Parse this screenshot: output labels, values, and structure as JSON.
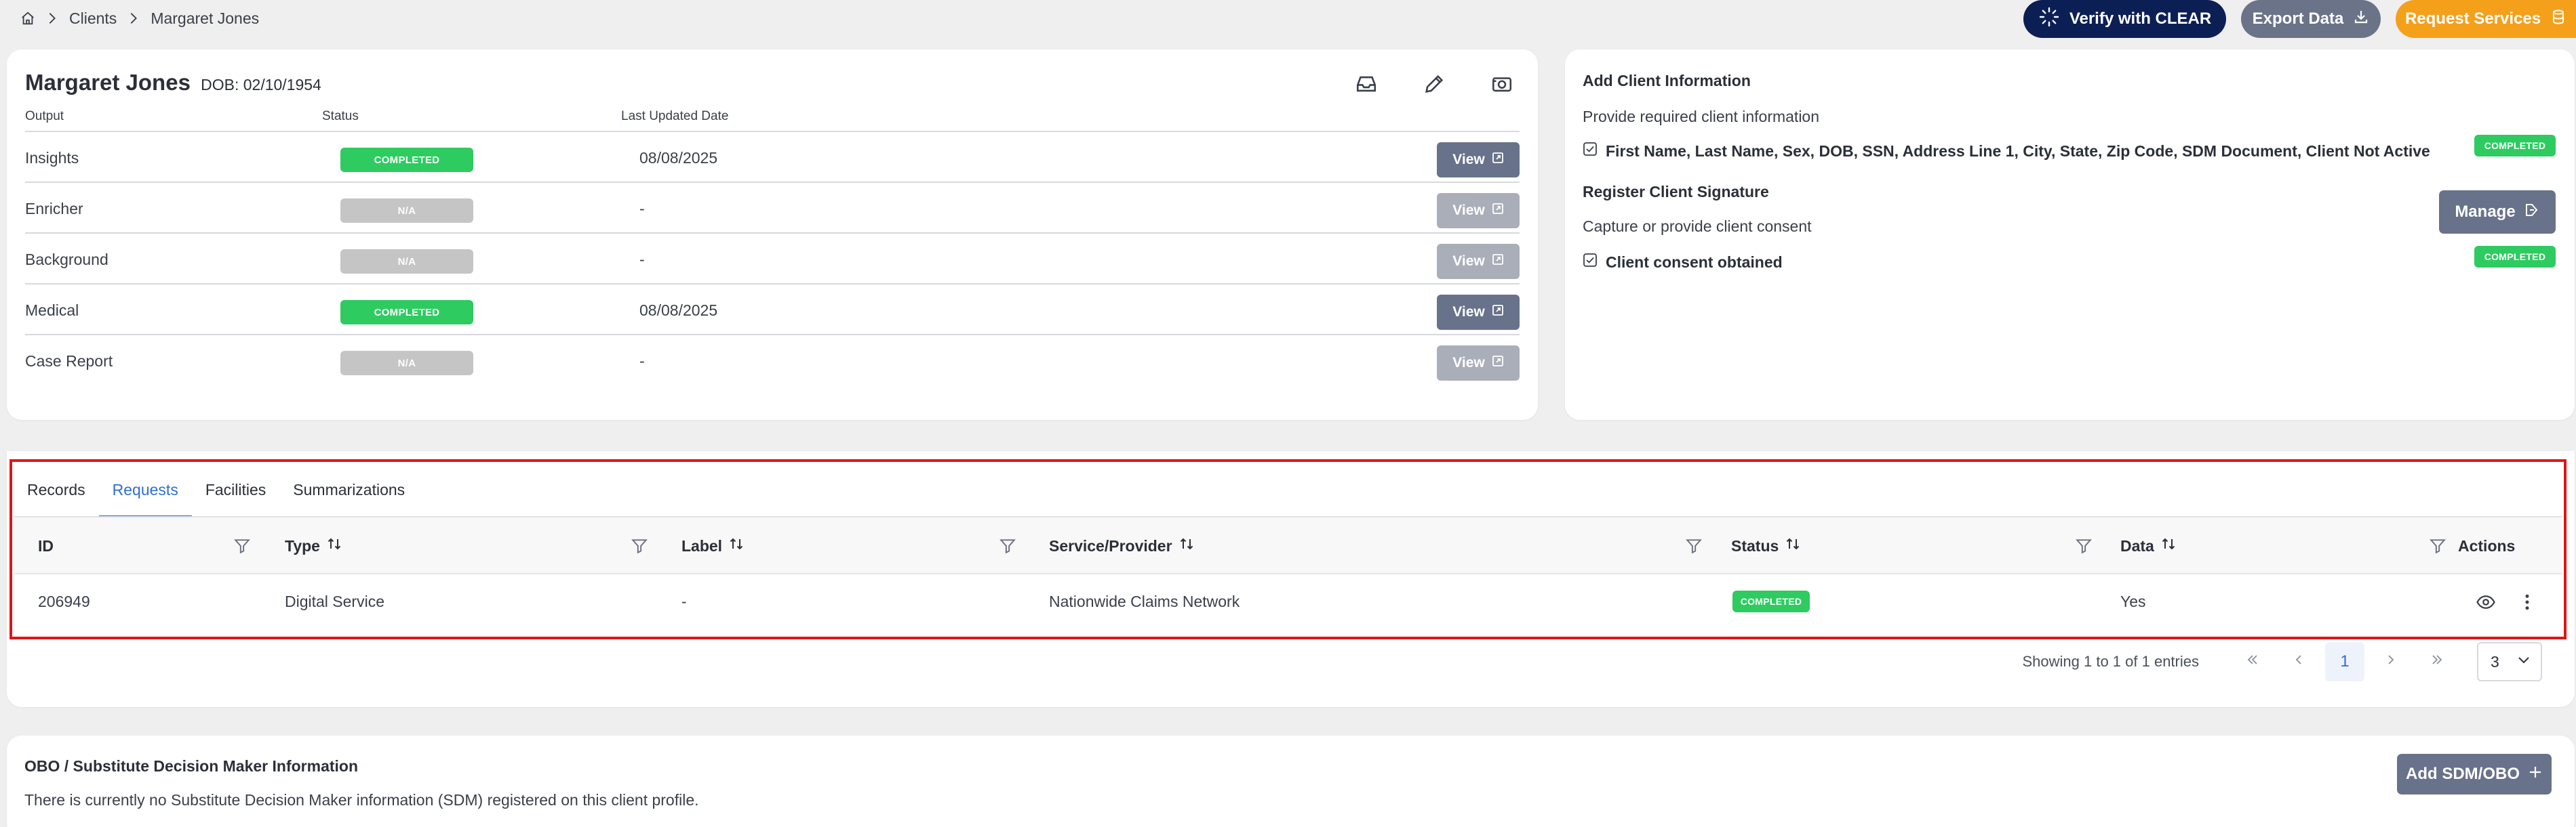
{
  "breadcrumb": {
    "home_icon": "home-icon",
    "items": [
      "Clients",
      "Margaret Jones"
    ]
  },
  "actions": {
    "verify_label": "Verify with CLEAR",
    "export_label": "Export Data",
    "request_label": "Request Services"
  },
  "client": {
    "name": "Margaret Jones",
    "dob": "DOB: 02/10/1954",
    "icons": [
      "inbox-icon",
      "edit-icon",
      "camera-icon"
    ],
    "columns": {
      "output": "Output",
      "status": "Status",
      "updated": "Last Updated Date"
    },
    "view_label": "View",
    "outputs": [
      {
        "name": "Insights",
        "status": "COMPLETED",
        "date": "08/08/2025",
        "enabled": true
      },
      {
        "name": "Enricher",
        "status": "N/A",
        "date": "-",
        "enabled": false
      },
      {
        "name": "Background",
        "status": "N/A",
        "date": "-",
        "enabled": false
      },
      {
        "name": "Medical",
        "status": "COMPLETED",
        "date": "08/08/2025",
        "enabled": true
      },
      {
        "name": "Case Report",
        "status": "N/A",
        "date": "-",
        "enabled": false
      }
    ]
  },
  "client_info": {
    "add_title": "Add Client Information",
    "add_desc": "Provide required client information",
    "add_fields": "First Name, Last Name, Sex, DOB, SSN, Address Line 1, City, State, Zip Code, SDM Document, Client Not Active",
    "add_status": "COMPLETED",
    "sig_title": "Register Client Signature",
    "sig_desc": "Capture or provide client consent",
    "sig_check": "Client consent obtained",
    "sig_status": "COMPLETED",
    "manage_label": "Manage"
  },
  "tabs": [
    {
      "label": "Records",
      "active": false
    },
    {
      "label": "Requests",
      "active": true
    },
    {
      "label": "Facilities",
      "active": false
    },
    {
      "label": "Summarizations",
      "active": false
    }
  ],
  "table": {
    "headers": {
      "id": "ID",
      "type": "Type",
      "label": "Label",
      "service": "Service/Provider",
      "status": "Status",
      "data": "Data",
      "actions": "Actions"
    },
    "rows": [
      {
        "id": "206949",
        "type": "Digital Service",
        "label": "-",
        "service": "Nationwide Claims Network",
        "status": "COMPLETED",
        "data": "Yes"
      }
    ]
  },
  "pagination": {
    "summary": "Showing 1 to 1 of 1 entries",
    "current_page": "1",
    "page_size": "3"
  },
  "sdm": {
    "title": "OBO / Substitute Decision Maker Information",
    "text": "There is currently no Substitute Decision Maker information (SDM) registered on this client profile.",
    "button_label": "Add SDM/OBO"
  },
  "colors": {
    "primary_dark": "#0c1f55",
    "slate": "#68728a",
    "orange": "#f5a01a",
    "green": "#2ecb61",
    "blue": "#2f6fd6",
    "highlight_red": "#e01616"
  }
}
